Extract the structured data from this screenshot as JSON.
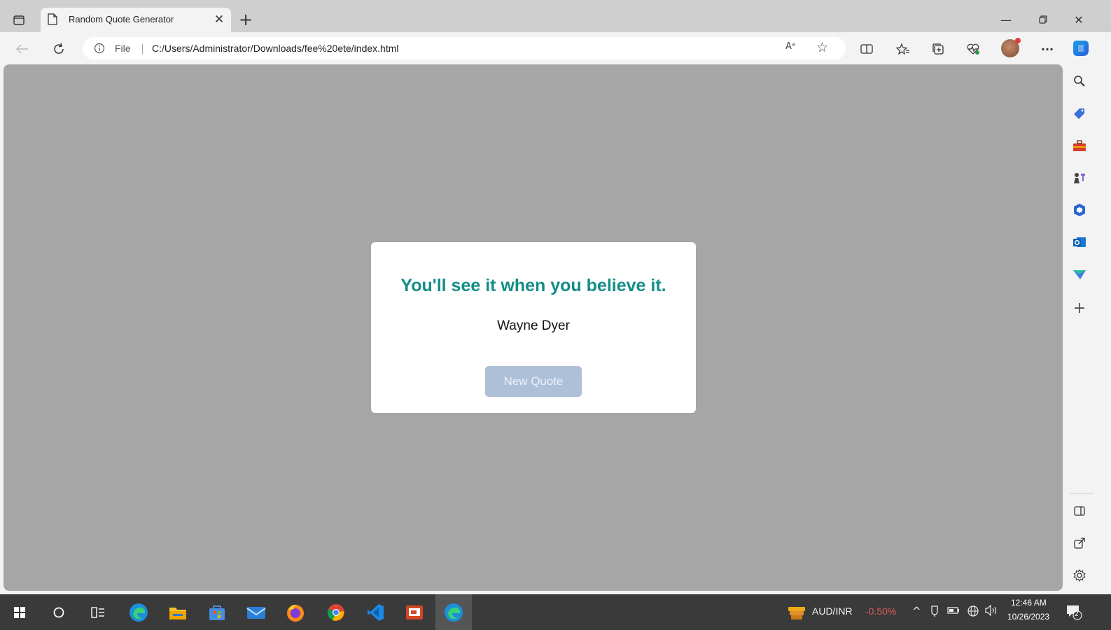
{
  "browser": {
    "tab": {
      "title": "Random Quote Generator"
    },
    "address_bar": {
      "scheme_label": "File",
      "separator": "|",
      "url": "C:/Users/Administrator/Downloads/fee%20ete/index.html",
      "read_aloud_glyph": "Aᵃ"
    },
    "icons": {
      "tab_actions": "tab-actions-icon",
      "page": "page-icon",
      "close_tab": "close-icon",
      "new_tab": "plus-icon",
      "minimize": "minimize-icon",
      "restore": "restore-icon",
      "close_window": "close-icon",
      "back": "back-arrow-icon",
      "refresh": "refresh-icon",
      "info": "info-icon",
      "favorite": "star-icon",
      "split_screen": "split-screen-icon",
      "favorites": "favorites-icon",
      "collections": "collections-icon",
      "performance": "heartbeat-icon",
      "profile": "profile-avatar",
      "more": "ellipsis-icon",
      "copilot": "copilot-icon"
    }
  },
  "page": {
    "background": "#a6a6a6",
    "quote": "You'll see it when you believe it.",
    "author": "Wayne Dyer",
    "button_label": "New Quote",
    "accent_color": "#138d87",
    "button_color": "#aebfd8"
  },
  "sidebar": {
    "items": [
      "search-icon",
      "tag-icon",
      "toolbox-icon",
      "chess-icon",
      "office-icon",
      "outlook-icon",
      "send-icon",
      "plus-icon"
    ],
    "bottom": [
      "sidebar-toggle-icon",
      "external-link-icon",
      "settings-icon"
    ]
  },
  "taskbar": {
    "apps": [
      "windows-start-icon",
      "search-circle-icon",
      "task-view-icon",
      "edge-icon",
      "file-explorer-icon",
      "store-icon",
      "mail-icon",
      "firefox-icon",
      "chrome-icon",
      "vscode-icon",
      "presentation-icon",
      "edge-icon"
    ],
    "ticker": {
      "pair": "AUD/INR",
      "change": "-0.50%"
    },
    "clock": {
      "time": "12:46 AM",
      "date": "10/26/2023"
    },
    "notifications": "2"
  }
}
